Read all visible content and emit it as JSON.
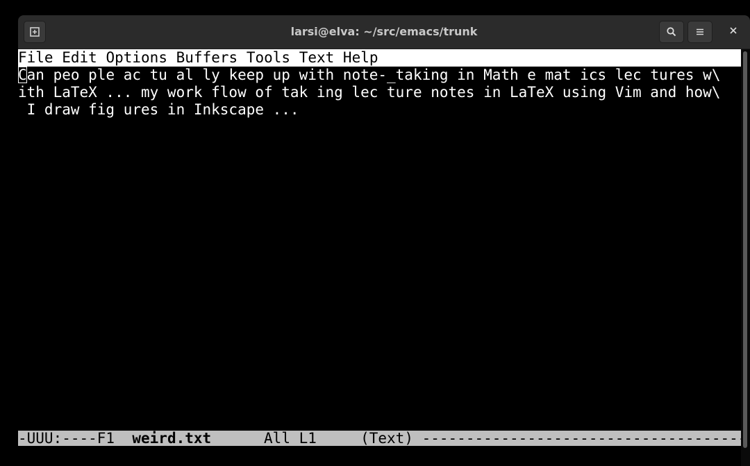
{
  "window": {
    "title": "larsi@elva: ~/src/emacs/trunk"
  },
  "titlebar_icons": {
    "new_tab": "new-tab-icon",
    "search": "search-icon",
    "menu": "hamburger-menu-icon",
    "close": "close-icon"
  },
  "menubar": {
    "items": [
      "File",
      "Edit",
      "Options",
      "Buffers",
      "Tools",
      "Text",
      "Help"
    ]
  },
  "buffer": {
    "cursor_char": "C",
    "line1_rest": "an peo ple ac tu al ly keep up with note-_taking in Math e mat ics lec tures w\\",
    "line2": "ith LaTeX ... my work flow of tak ing lec ture notes in LaTeX using Vim and how\\",
    "line3": " I draw fig ures in Inkscape ..."
  },
  "modeline": {
    "prefix": "-UUU:----F1  ",
    "buffer_name": "weird.txt",
    "position": "      All L1     ",
    "mode": "(Text)",
    "fill": " ---------------------------------------------------------------------"
  },
  "colors": {
    "background": "#000000",
    "foreground": "#ffffff",
    "menubar_bg": "#ffffff",
    "modeline_bg": "#bfbfbf",
    "titlebar_bg": "#2b2b2b"
  }
}
